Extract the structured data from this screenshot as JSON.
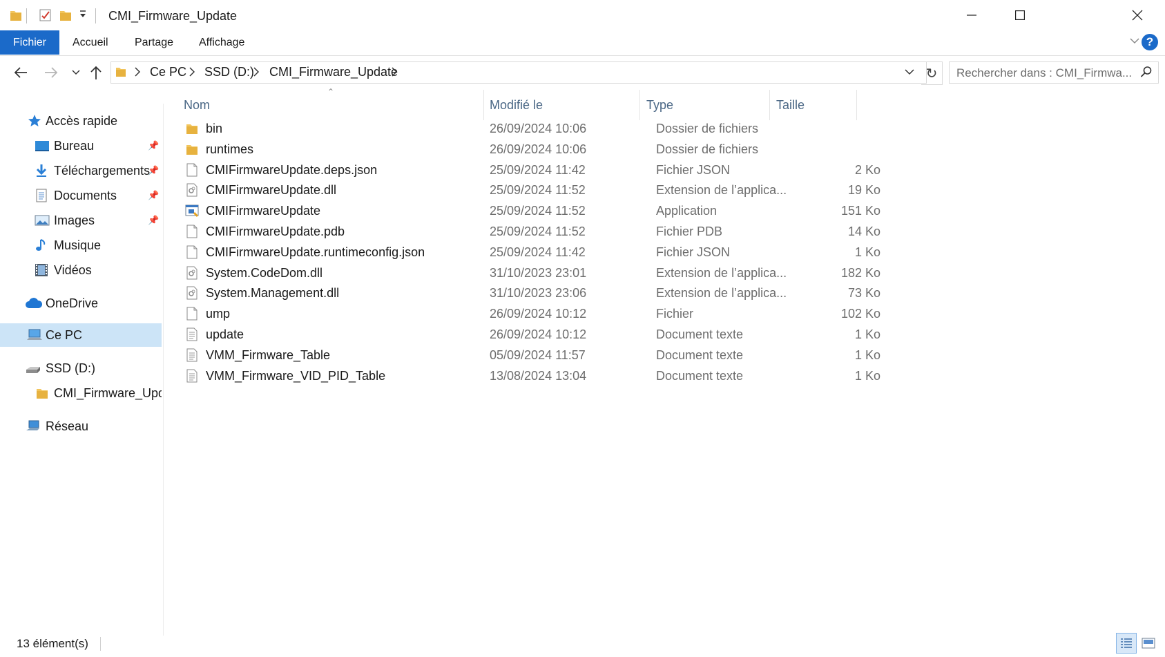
{
  "window": {
    "title": "CMI_Firmware_Update"
  },
  "ribbon": {
    "tabs": [
      {
        "label": "Fichier"
      },
      {
        "label": "Accueil"
      },
      {
        "label": "Partage"
      },
      {
        "label": "Affichage"
      }
    ]
  },
  "address": {
    "crumbs": [
      "Ce PC",
      "SSD (D:)",
      "CMI_Firmware_Update"
    ]
  },
  "search": {
    "placeholder": "Rechercher dans : CMI_Firmwa..."
  },
  "sidebar": {
    "items": [
      {
        "label": "Accès rapide",
        "icon": "star-icon"
      },
      {
        "label": "Bureau",
        "icon": "desktop-icon",
        "pinned": true
      },
      {
        "label": "Téléchargements",
        "icon": "download-icon",
        "pinned": true
      },
      {
        "label": "Documents",
        "icon": "documents-icon",
        "pinned": true
      },
      {
        "label": "Images",
        "icon": "images-icon",
        "pinned": true
      },
      {
        "label": "Musique",
        "icon": "music-icon"
      },
      {
        "label": "Vidéos",
        "icon": "videos-icon"
      },
      {
        "label": "OneDrive",
        "icon": "cloud-icon"
      },
      {
        "label": "Ce PC",
        "icon": "computer-icon",
        "selected": true
      },
      {
        "label": "SSD (D:)",
        "icon": "drive-icon"
      },
      {
        "label": "CMI_Firmware_Upda",
        "icon": "folder-icon"
      },
      {
        "label": "Réseau",
        "icon": "network-icon"
      }
    ]
  },
  "columns": [
    "Nom",
    "Modifié le",
    "Type",
    "Taille"
  ],
  "files": [
    {
      "name": "bin",
      "modified": "26/09/2024 10:06",
      "type": "Dossier de fichiers",
      "size": "",
      "icon": "folder-icon"
    },
    {
      "name": "runtimes",
      "modified": "26/09/2024 10:06",
      "type": "Dossier de fichiers",
      "size": "",
      "icon": "folder-icon"
    },
    {
      "name": "CMIFirmwareUpdate.deps.json",
      "modified": "25/09/2024 11:42",
      "type": "Fichier JSON",
      "size": "2 Ko",
      "icon": "file-icon"
    },
    {
      "name": "CMIFirmwareUpdate.dll",
      "modified": "25/09/2024 11:52",
      "type": "Extension de l’applica...",
      "size": "19 Ko",
      "icon": "dll-icon"
    },
    {
      "name": "CMIFirmwareUpdate",
      "modified": "25/09/2024 11:52",
      "type": "Application",
      "size": "151 Ko",
      "icon": "app-icon"
    },
    {
      "name": "CMIFirmwareUpdate.pdb",
      "modified": "25/09/2024 11:52",
      "type": "Fichier PDB",
      "size": "14 Ko",
      "icon": "file-icon"
    },
    {
      "name": "CMIFirmwareUpdate.runtimeconfig.json",
      "modified": "25/09/2024 11:42",
      "type": "Fichier JSON",
      "size": "1 Ko",
      "icon": "file-icon"
    },
    {
      "name": "System.CodeDom.dll",
      "modified": "31/10/2023 23:01",
      "type": "Extension de l’applica...",
      "size": "182 Ko",
      "icon": "dll-icon"
    },
    {
      "name": "System.Management.dll",
      "modified": "31/10/2023 23:06",
      "type": "Extension de l’applica...",
      "size": "73 Ko",
      "icon": "dll-icon"
    },
    {
      "name": "ump",
      "modified": "26/09/2024 10:12",
      "type": "Fichier",
      "size": "102 Ko",
      "icon": "file-icon"
    },
    {
      "name": "update",
      "modified": "26/09/2024 10:12",
      "type": "Document texte",
      "size": "1 Ko",
      "icon": "text-file-icon"
    },
    {
      "name": "VMM_Firmware_Table",
      "modified": "05/09/2024 11:57",
      "type": "Document texte",
      "size": "1 Ko",
      "icon": "text-file-icon"
    },
    {
      "name": "VMM_Firmware_VID_PID_Table",
      "modified": "13/08/2024 13:04",
      "type": "Document texte",
      "size": "1 Ko",
      "icon": "text-file-icon"
    }
  ],
  "status": {
    "count": "13 élément(s)"
  },
  "colors": {
    "accent": "#1b6ac9",
    "selection": "#cce4f7",
    "folder": "#f2c55c"
  }
}
